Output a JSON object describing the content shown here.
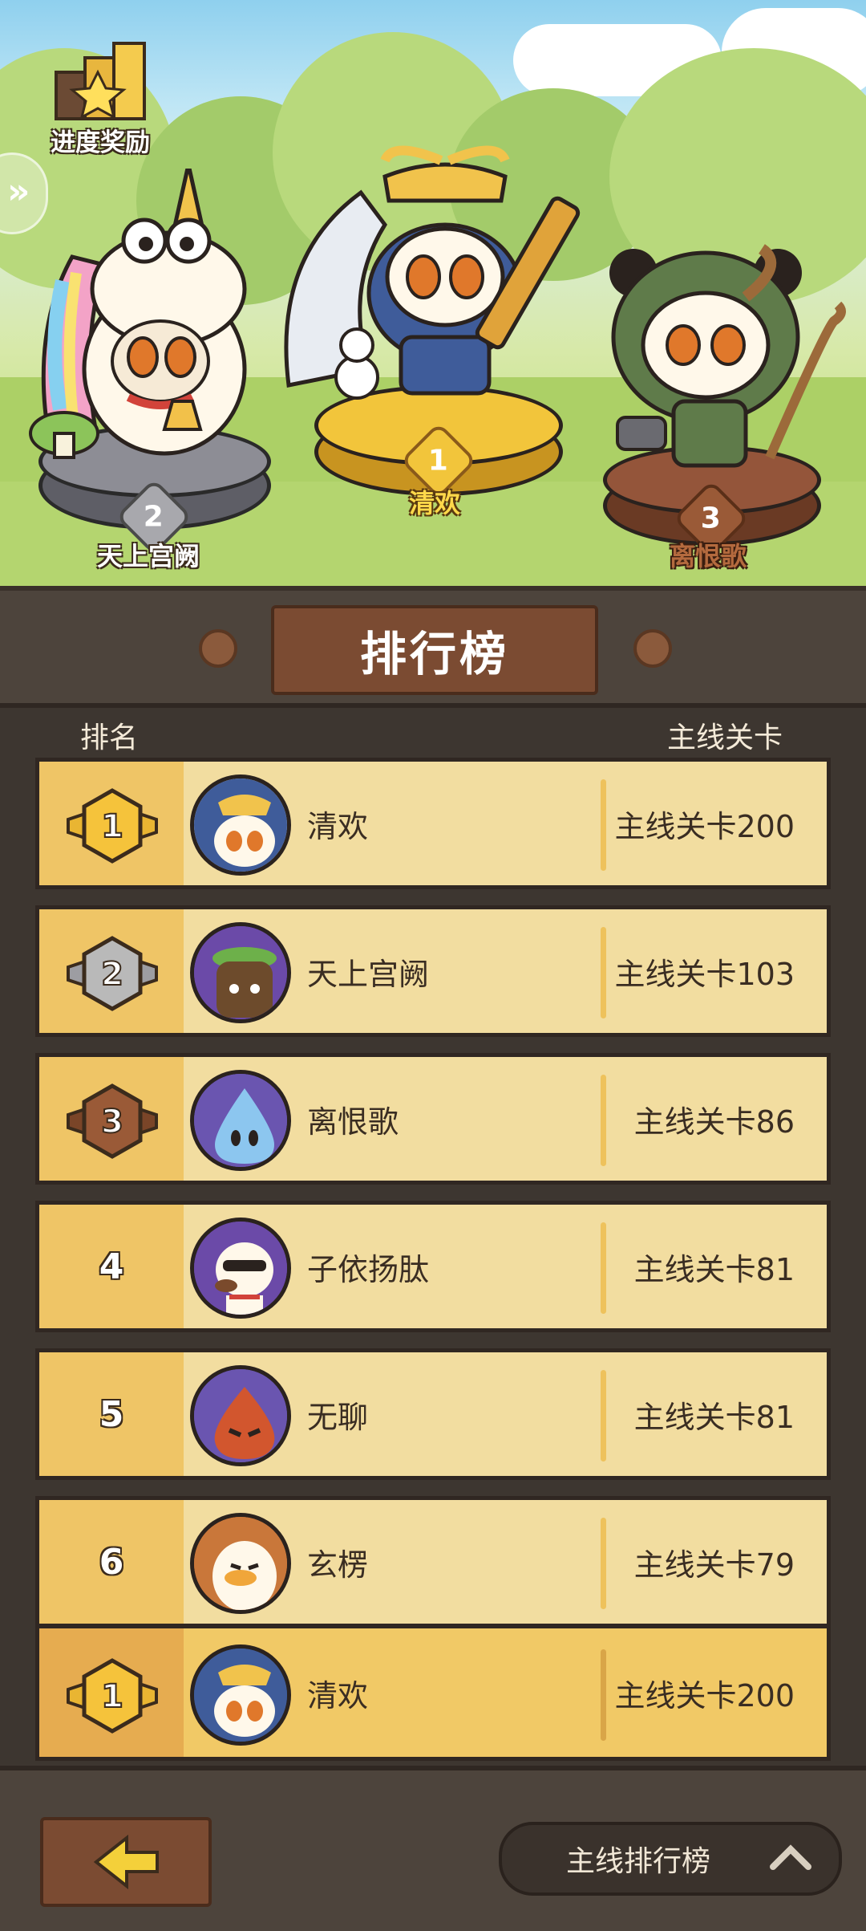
{
  "reward": {
    "label": "进度奖励"
  },
  "podium": [
    {
      "rank": "2",
      "name": "天上宫阙"
    },
    {
      "rank": "1",
      "name": "清欢"
    },
    {
      "rank": "3",
      "name": "离恨歌"
    }
  ],
  "leaderboard": {
    "title": "排行榜",
    "col_rank": "排名",
    "col_score": "主线关卡",
    "rows": [
      {
        "rank": "1",
        "name": "清欢",
        "score": "主线关卡200"
      },
      {
        "rank": "2",
        "name": "天上宫阙",
        "score": "主线关卡103"
      },
      {
        "rank": "3",
        "name": "离恨歌",
        "score": "主线关卡86"
      },
      {
        "rank": "4",
        "name": "子依扬肽",
        "score": "主线关卡81"
      },
      {
        "rank": "5",
        "name": "无聊",
        "score": "主线关卡81"
      },
      {
        "rank": "6",
        "name": "玄楞",
        "score": "主线关卡79"
      }
    ],
    "me": {
      "rank": "1",
      "name": "清欢",
      "score": "主线关卡200"
    }
  },
  "footer": {
    "switch_label": "主线排行榜"
  },
  "colors": {
    "gold": "#f5c33b",
    "silver": "#b9b9b9",
    "bronze": "#9a5a37",
    "row_bg": "#f2dda0"
  },
  "icons": [
    "trophy-stairs-icon",
    "chevron-right-icon",
    "back-arrow-icon",
    "chevron-up-icon"
  ]
}
